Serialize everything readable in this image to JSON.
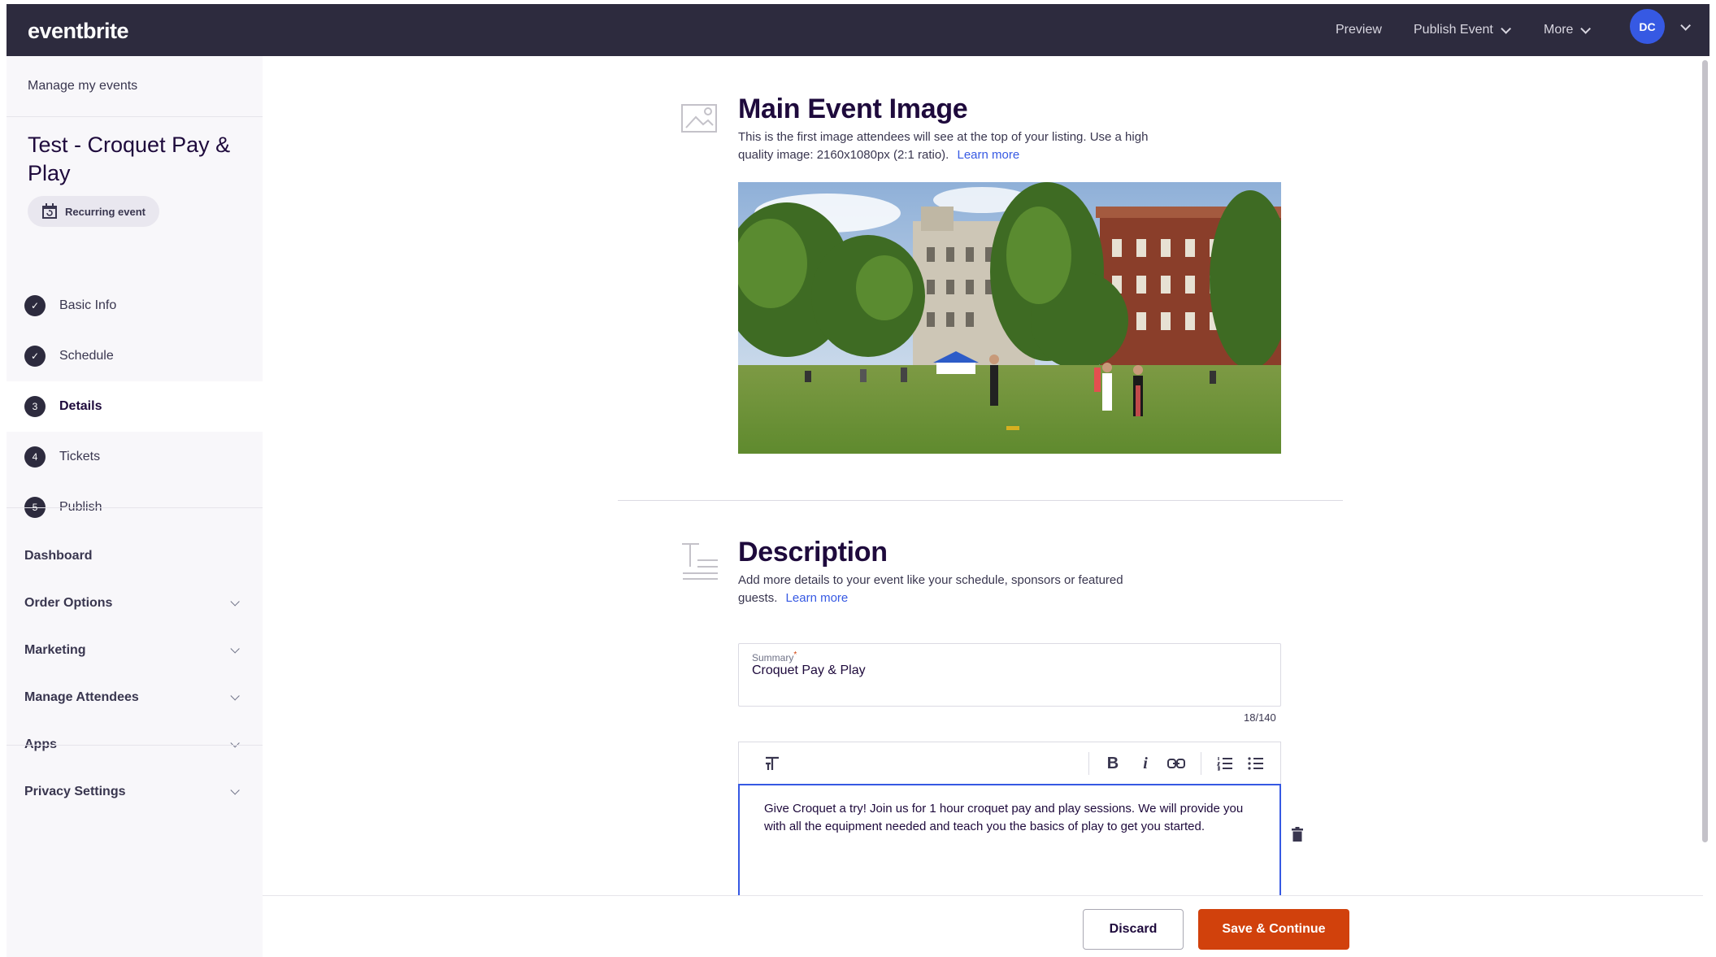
{
  "topbar": {
    "logo": "eventbrite",
    "preview_label": "Preview",
    "publish_label": "Publish Event",
    "more_label": "More",
    "avatar_initials": "DC"
  },
  "sidebar": {
    "manage_link": "Manage my events",
    "event_title": "Test - Croquet Pay & Play",
    "badge_label": "Recurring event",
    "steps": [
      {
        "number": "✓",
        "label": "Basic Info",
        "state": "complete"
      },
      {
        "number": "✓",
        "label": "Schedule",
        "state": "complete"
      },
      {
        "number": "3",
        "label": "Details",
        "state": "active"
      },
      {
        "number": "4",
        "label": "Tickets",
        "state": "pending"
      },
      {
        "number": "5",
        "label": "Publish",
        "state": "pending"
      }
    ],
    "dashboard_label": "Dashboard",
    "sections": [
      {
        "label": "Order Options"
      },
      {
        "label": "Marketing"
      },
      {
        "label": "Manage Attendees"
      },
      {
        "label": "Apps"
      },
      {
        "label": "Privacy Settings"
      }
    ]
  },
  "main_image": {
    "title": "Main Event Image",
    "description": "This is the first image attendees will see at the top of your listing. Use a high quality image: 2160x1080px (2:1 ratio).",
    "learn_more": "Learn more"
  },
  "description": {
    "title": "Description",
    "text": "Add more details to your event like your schedule, sponsors or featured guests.",
    "learn_more": "Learn more",
    "summary_label": "Summary",
    "summary_required": "*",
    "summary_value": "Croquet Pay & Play",
    "char_count": "18/140",
    "editor_text": "Give Croquet a try! Join us for 1 hour croquet pay and play sessions. We will provide you with all the equipment needed and teach you the basics of play to get you started."
  },
  "footer": {
    "discard_label": "Discard",
    "save_label": "Save & Continue"
  },
  "colors": {
    "topbar": "#2d2b3e",
    "accent_blue": "#3659e3",
    "brand_orange": "#d1410c"
  }
}
